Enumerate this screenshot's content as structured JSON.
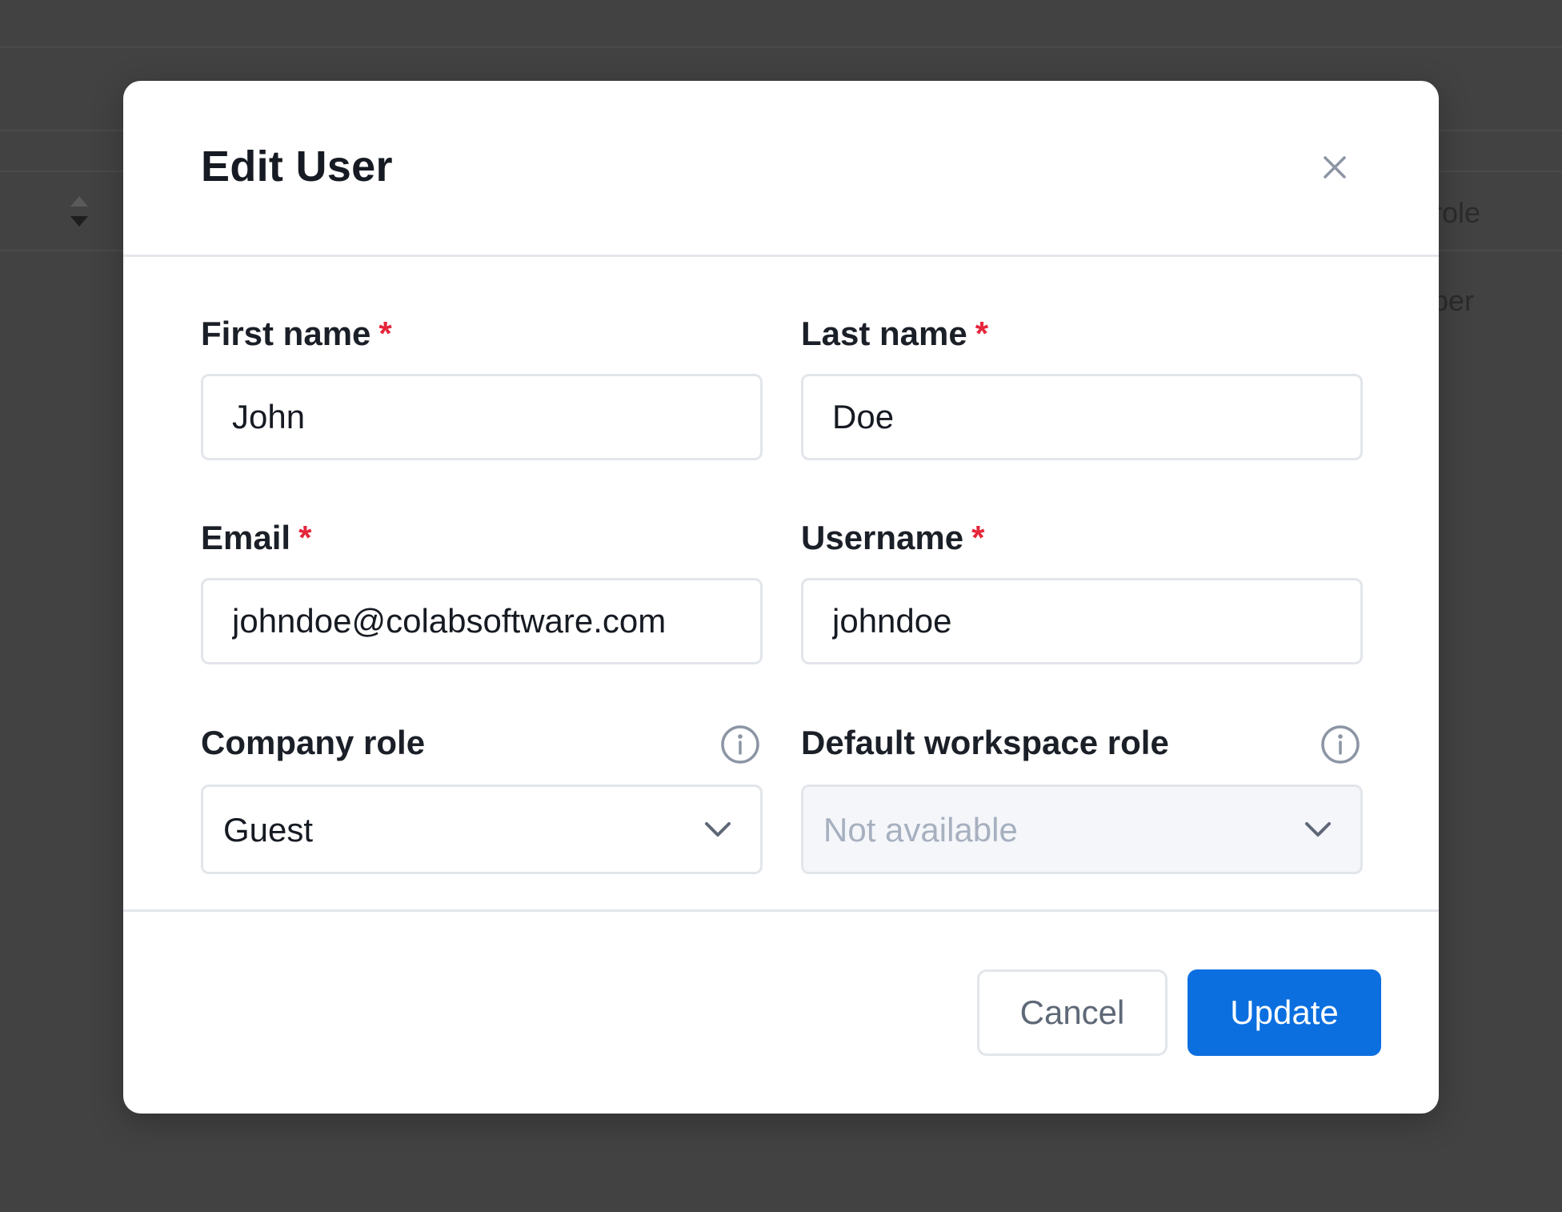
{
  "background": {
    "column_header_partial": "role",
    "cell_partial": "ber"
  },
  "modal": {
    "title": "Edit User",
    "close_icon": "close-icon",
    "fields": {
      "first_name": {
        "label": "First name",
        "required_mark": "*",
        "value": "John"
      },
      "last_name": {
        "label": "Last name",
        "required_mark": "*",
        "value": "Doe"
      },
      "email": {
        "label": "Email",
        "required_mark": "*",
        "value": "johndoe@colabsoftware.com"
      },
      "username": {
        "label": "Username",
        "required_mark": "*",
        "value": "johndoe"
      },
      "company_role": {
        "label": "Company role",
        "value": "Guest",
        "info_icon": "info-icon"
      },
      "default_workspace_role": {
        "label": "Default workspace role",
        "value": "Not available",
        "disabled": true,
        "info_icon": "info-icon"
      }
    },
    "buttons": {
      "cancel": "Cancel",
      "update": "Update"
    },
    "colors": {
      "primary": "#0b6fe0",
      "required": "#e5253a",
      "backdrop": "#424242"
    }
  }
}
